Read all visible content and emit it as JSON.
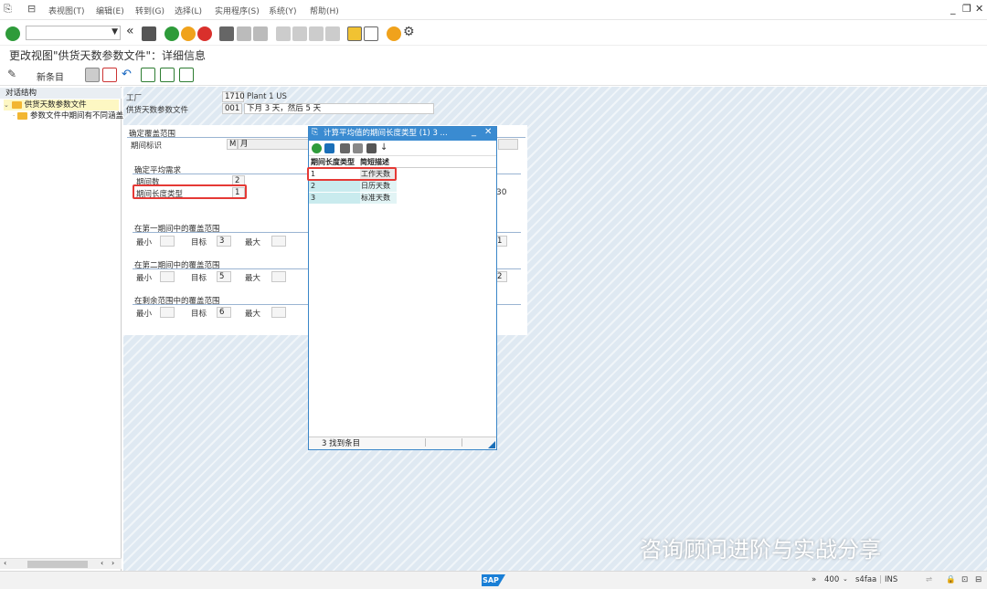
{
  "menu": [
    "表视图(T)",
    "编辑(E)",
    "转到(G)",
    "选择(L)",
    "实用程序(S)",
    "系统(Y)",
    "帮助(H)"
  ],
  "title": "更改视图\"供货天数参数文件\"：详细信息",
  "app_toolbar": {
    "new_entries": "新条目"
  },
  "tree": {
    "header": "对话结构",
    "node1": "供货天数参数文件",
    "node2": "参数文件中期间有不同涵盖"
  },
  "form": {
    "plant_label": "工厂",
    "plant_code": "1710",
    "plant_name": "Plant 1 US",
    "profile_label": "供货天数参数文件",
    "profile_code": "001",
    "profile_desc": "下月 3 天，然后 5 天",
    "group1_title": "确定覆盖范围",
    "period_indicator_label": "期间标识",
    "period_indicator_value": "M",
    "period_indicator_text": "月",
    "group2_title": "确定平均需求",
    "num_periods_label": "期间数",
    "num_periods_value": "2",
    "period_length_label": "期间长度类型",
    "period_length_value": "1",
    "right_value_30": "30",
    "range1_title": "在第一期间中的覆盖范围",
    "range2_title": "在第二期间中的覆盖范围",
    "range3_title": "在剩余范围中的覆盖范围",
    "min_label": "最小",
    "target_label": "目标",
    "max_label": "最大",
    "target1": "3",
    "target2": "5",
    "target3": "6",
    "right_value_1": "1",
    "right_value_2": "2"
  },
  "popup": {
    "title": "计算平均值的期间长度类型 (1)   3 ...",
    "col1": "期间长度类型",
    "col2": "简短描述",
    "rows": [
      {
        "key": "1",
        "desc": "工作天数"
      },
      {
        "key": "2",
        "desc": "日历天数"
      },
      {
        "key": "3",
        "desc": "标准天数"
      }
    ],
    "footer": "3 找到条目"
  },
  "status": {
    "sap": "SAP",
    "zoom": "400",
    "system": "s4faa",
    "mode": "INS"
  },
  "watermark": "咨询顾问进阶与实战分享"
}
